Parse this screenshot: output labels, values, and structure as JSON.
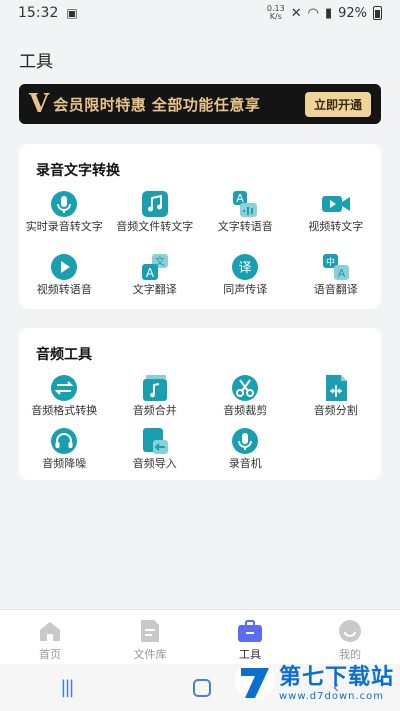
{
  "status_bar": {
    "time": "15:32",
    "net_speed_value": "0.13",
    "net_speed_unit": "K/s",
    "battery": "92%"
  },
  "page_title": "工具",
  "vip_banner": {
    "logo": "V",
    "text": "会员限时特惠  全部功能任意享",
    "button": "立即开通"
  },
  "sections": [
    {
      "title": "录音文字转换",
      "tools": [
        {
          "label": "实时录音转文字",
          "icon": "microphone-icon",
          "color": "#1a9fb0"
        },
        {
          "label": "音频文件转文字",
          "icon": "music-note-icon",
          "color": "#1a9fb0"
        },
        {
          "label": "文字转语音",
          "icon": "text-to-speech-icon",
          "color": "#1a9fb0"
        },
        {
          "label": "视频转文字",
          "icon": "video-camera-icon",
          "color": "#1a9fb0"
        },
        {
          "label": "视频转语音",
          "icon": "play-icon",
          "color": "#1a9fb0"
        },
        {
          "label": "文字翻译",
          "icon": "translate-text-icon",
          "color": "#1a9fb0"
        },
        {
          "label": "同声传译",
          "icon": "interpret-icon",
          "color": "#1a9fb0"
        },
        {
          "label": "语音翻译",
          "icon": "voice-translate-icon",
          "color": "#1a9fb0"
        }
      ]
    },
    {
      "title": "音频工具",
      "tools": [
        {
          "label": "音频格式转换",
          "icon": "format-convert-icon",
          "color": "#1a9fb0"
        },
        {
          "label": "音频合并",
          "icon": "merge-icon",
          "color": "#1a9fb0"
        },
        {
          "label": "音频裁剪",
          "icon": "scissors-icon",
          "color": "#1a9fb0"
        },
        {
          "label": "音频分割",
          "icon": "split-icon",
          "color": "#1a9fb0"
        },
        {
          "label": "音频降噪",
          "icon": "headphones-icon",
          "color": "#1a9fb0"
        },
        {
          "label": "音频导入",
          "icon": "import-icon",
          "color": "#1a9fb0"
        },
        {
          "label": "录音机",
          "icon": "recorder-icon",
          "color": "#1a9fb0"
        }
      ]
    }
  ],
  "bottom_nav": [
    {
      "label": "首页",
      "icon": "home-icon",
      "active": false
    },
    {
      "label": "文件库",
      "icon": "file-library-icon",
      "active": false
    },
    {
      "label": "工具",
      "icon": "toolbox-icon",
      "active": true
    },
    {
      "label": "我的",
      "icon": "profile-icon",
      "active": false
    }
  ],
  "watermark": {
    "main": "第七下载站",
    "sub": "www.d7down.com"
  },
  "colors": {
    "accent": "#1a9fb0",
    "nav_active": "#5a6cf0",
    "vip_gold": "#e8c48a"
  }
}
